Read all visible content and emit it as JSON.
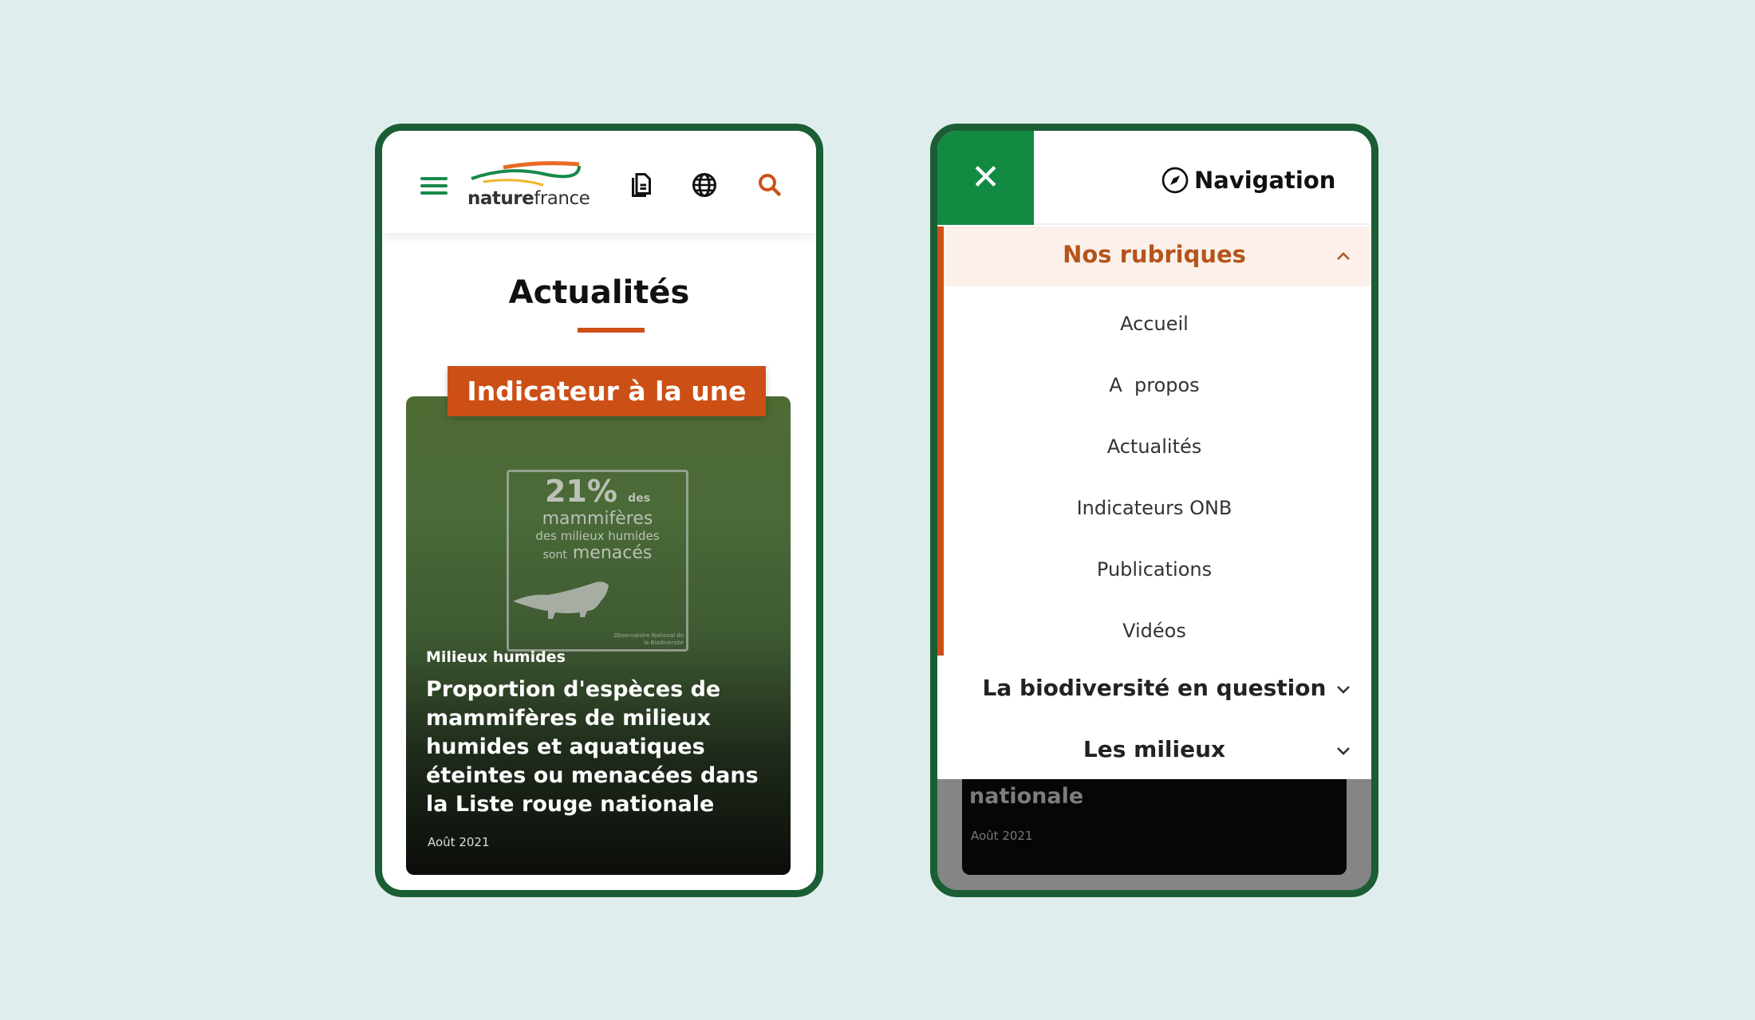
{
  "left_phone": {
    "logo": {
      "text_bold": "nature",
      "text_light": "france"
    },
    "icons": [
      "menu-icon",
      "document-icon",
      "globe-icon",
      "search-icon"
    ],
    "page_title": "Actualités",
    "badge": "Indicateur à la une",
    "card": {
      "image_text": {
        "percent": "21%",
        "des": "des",
        "line1": "mammifères",
        "line2": "des milieux humides",
        "sont": "sont",
        "menaces": "menacés",
        "source": "Observatoire National de la Biodiversité"
      },
      "category": "Milieux humides",
      "title": "Proportion d'espèces de mammifères de milieux humides et aquatiques éteintes ou menacées dans la Liste rouge nationale",
      "date": "Août 2021"
    }
  },
  "right_phone": {
    "close_icon": "close-icon",
    "nav_title": "Navigation",
    "section": {
      "label": "Nos rubriques",
      "expanded": true,
      "items": [
        "Accueil",
        "A  propos",
        "Actualités",
        "Indicateurs ONB",
        "Publications",
        "Vidéos"
      ]
    },
    "groups": [
      {
        "label": "La biodiversité en question",
        "expanded": false
      },
      {
        "label": "Les milieux",
        "expanded": false
      }
    ],
    "behind": {
      "title_tail": "nationale",
      "date": "Août 2021"
    }
  },
  "colors": {
    "background": "#dfeeed",
    "frame": "#1b5e35",
    "green": "#138a42",
    "orange": "#cc4f16",
    "rubriques_text": "#b5541c"
  }
}
